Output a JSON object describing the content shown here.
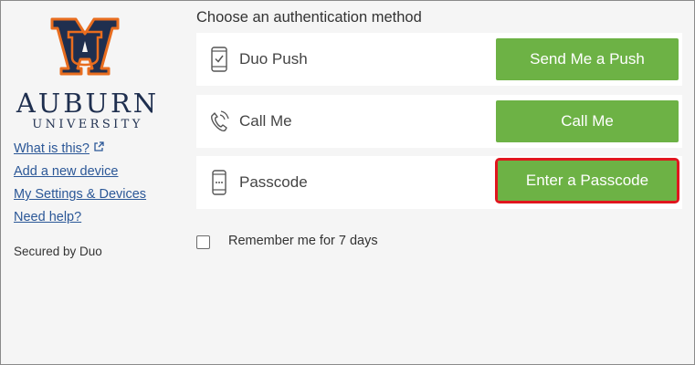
{
  "sidebar": {
    "logo_text_big": "AUBURN",
    "logo_text_small": "UNIVERSITY",
    "links": [
      {
        "label": "What is this?"
      },
      {
        "label": "Add a new device"
      },
      {
        "label": "My Settings & Devices"
      },
      {
        "label": "Need help?"
      }
    ],
    "secured_by": "Secured by Duo"
  },
  "main": {
    "heading": "Choose an authentication method",
    "methods": [
      {
        "label": "Duo Push",
        "icon": "smartphone-check-icon",
        "button": "Send Me a Push"
      },
      {
        "label": "Call Me",
        "icon": "phone-call-icon",
        "button": "Call Me"
      },
      {
        "label": "Passcode",
        "icon": "phone-passcode-icon",
        "button": "Enter a Passcode"
      }
    ],
    "remember_label": "Remember me for 7 days"
  },
  "colors": {
    "button_green": "#6db245",
    "highlight_red": "#e0161e",
    "link_blue": "#2b5797",
    "brand_navy": "#1f2f4f",
    "brand_orange": "#e86d1f"
  }
}
